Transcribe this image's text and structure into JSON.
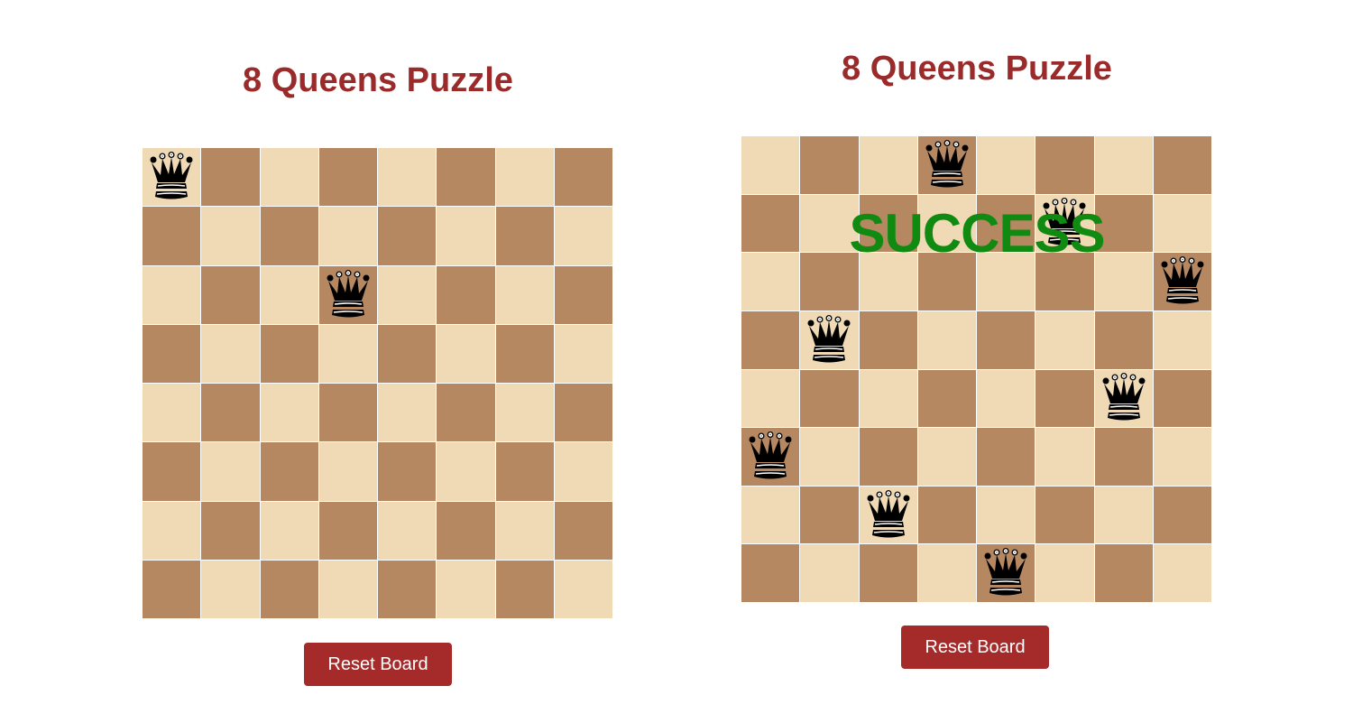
{
  "colors": {
    "title": "#9b2a2a",
    "light_square": "#f0dab5",
    "dark_square": "#b58862",
    "button_bg": "#a52a2a",
    "button_text": "#ffffff",
    "success_text": "#118a11",
    "queen": "#000000"
  },
  "queen_icon": "black-queen-icon",
  "boards": [
    {
      "title": "8 Queens Puzzle",
      "size": 8,
      "queens": [
        [
          0,
          0
        ],
        [
          2,
          3
        ]
      ],
      "status_text": "",
      "reset_label": "Reset Board"
    },
    {
      "title": "8 Queens Puzzle",
      "size": 8,
      "queens": [
        [
          0,
          3
        ],
        [
          1,
          5
        ],
        [
          2,
          7
        ],
        [
          3,
          1
        ],
        [
          4,
          6
        ],
        [
          5,
          0
        ],
        [
          6,
          2
        ],
        [
          7,
          4
        ]
      ],
      "status_text": "SUCCESS",
      "reset_label": "Reset Board"
    }
  ]
}
